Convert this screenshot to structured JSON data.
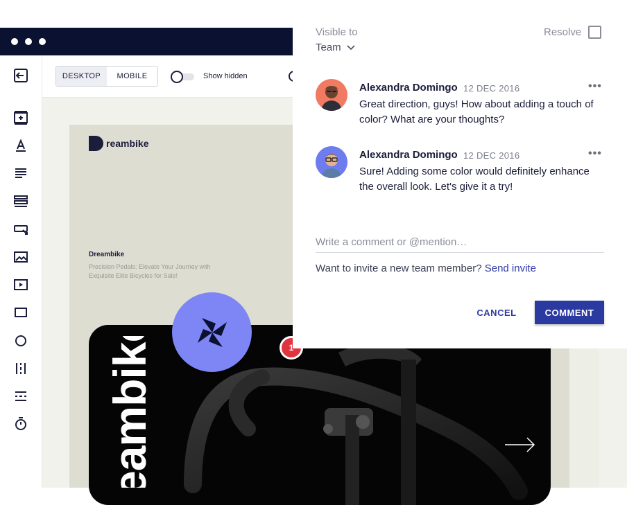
{
  "editor": {
    "view_tabs": [
      "DESKTOP",
      "MOBILE"
    ],
    "active_tab": "DESKTOP",
    "show_hidden_label": "Show hidden",
    "show_hidden_on": false,
    "sidebar_icons": [
      "exit-icon",
      "add-section-icon",
      "text-icon",
      "paragraph-icon",
      "list-icon",
      "button-icon",
      "image-icon",
      "video-icon",
      "rectangle-icon",
      "circle-icon",
      "columns-icon",
      "divider-icon",
      "timer-icon"
    ]
  },
  "design": {
    "logo_text": "reambike",
    "brand": "Dreambike",
    "tagline": "Precision Pedals: Elevate Your Journey with Exquisite Elite Bicycles for Sale!",
    "hero_text": "eambike"
  },
  "notification": {
    "count": "1",
    "color": "#e0343f"
  },
  "comments_panel": {
    "visible_to_label": "Visible to",
    "visibility": "Team",
    "resolve_label": "Resolve",
    "resolved": false,
    "comments": [
      {
        "author": "Alexandra Domingo",
        "date": "12 DEC 2016",
        "text": "Great direction, guys! How about adding a touch of color? What are your thoughts?",
        "avatar_color": "#f07b62"
      },
      {
        "author": "Alexandra Domingo",
        "date": "12 DEC 2016",
        "text": "Sure! Adding some color would definitely enhance the overall look. Let's give it a try!",
        "avatar_color": "#6f7cf0"
      }
    ],
    "input_placeholder": "Write a comment or @mention…",
    "invite_text": "Want to invite a new team member?",
    "invite_link": "Send invite",
    "cancel_label": "CANCEL",
    "submit_label": "COMMENT"
  },
  "colors": {
    "accent": "#2b3aa0",
    "titlebar": "#0b1130",
    "fab": "#7d86f4"
  }
}
